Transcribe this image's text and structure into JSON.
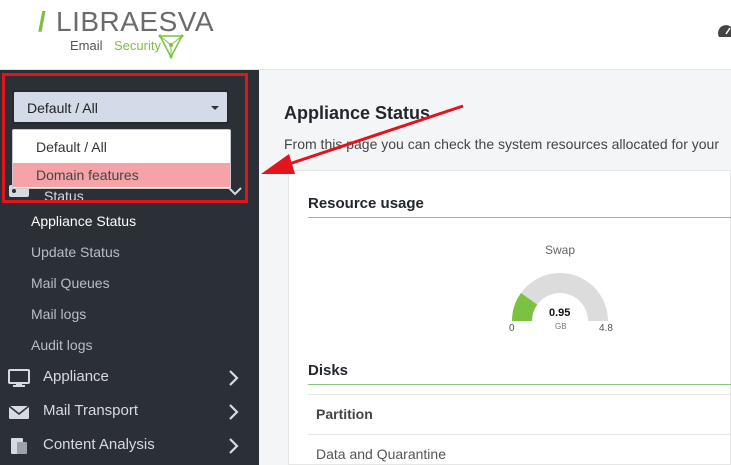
{
  "header": {
    "brand_slash": "/",
    "brand_name": "LIBRAESVA",
    "brand_sub_a": "Email",
    "brand_sub_b": "Security"
  },
  "dropdown": {
    "selected": "Default / All",
    "options": [
      "Default / All",
      "Domain features"
    ],
    "highlighted_index": 1
  },
  "sidebar": {
    "status_label": "Status",
    "sub_items": [
      "Appliance Status",
      "Update Status",
      "Mail Queues",
      "Mail logs",
      "Audit logs"
    ],
    "items": [
      {
        "label": "Appliance",
        "icon": "monitor-icon"
      },
      {
        "label": "Mail Transport",
        "icon": "envelope-icon"
      },
      {
        "label": "Content Analysis",
        "icon": "content-analysis-icon"
      }
    ]
  },
  "main": {
    "title": "Appliance Status",
    "description": "From this page you can check the system resources allocated for your",
    "resource_title": "Resource usage",
    "gauge": {
      "label": "Swap",
      "value": "0.95",
      "unit": "GB",
      "min": "0",
      "max": "4.8",
      "fraction": 0.198
    },
    "disks_title": "Disks",
    "disks_header": "Partition",
    "disks_rows": [
      "Data and Quarantine"
    ]
  },
  "colors": {
    "accent": "#7cc242",
    "sidebar": "#2b2f36",
    "highlight": "#f5a3a6",
    "annotation": "#e3141b"
  }
}
